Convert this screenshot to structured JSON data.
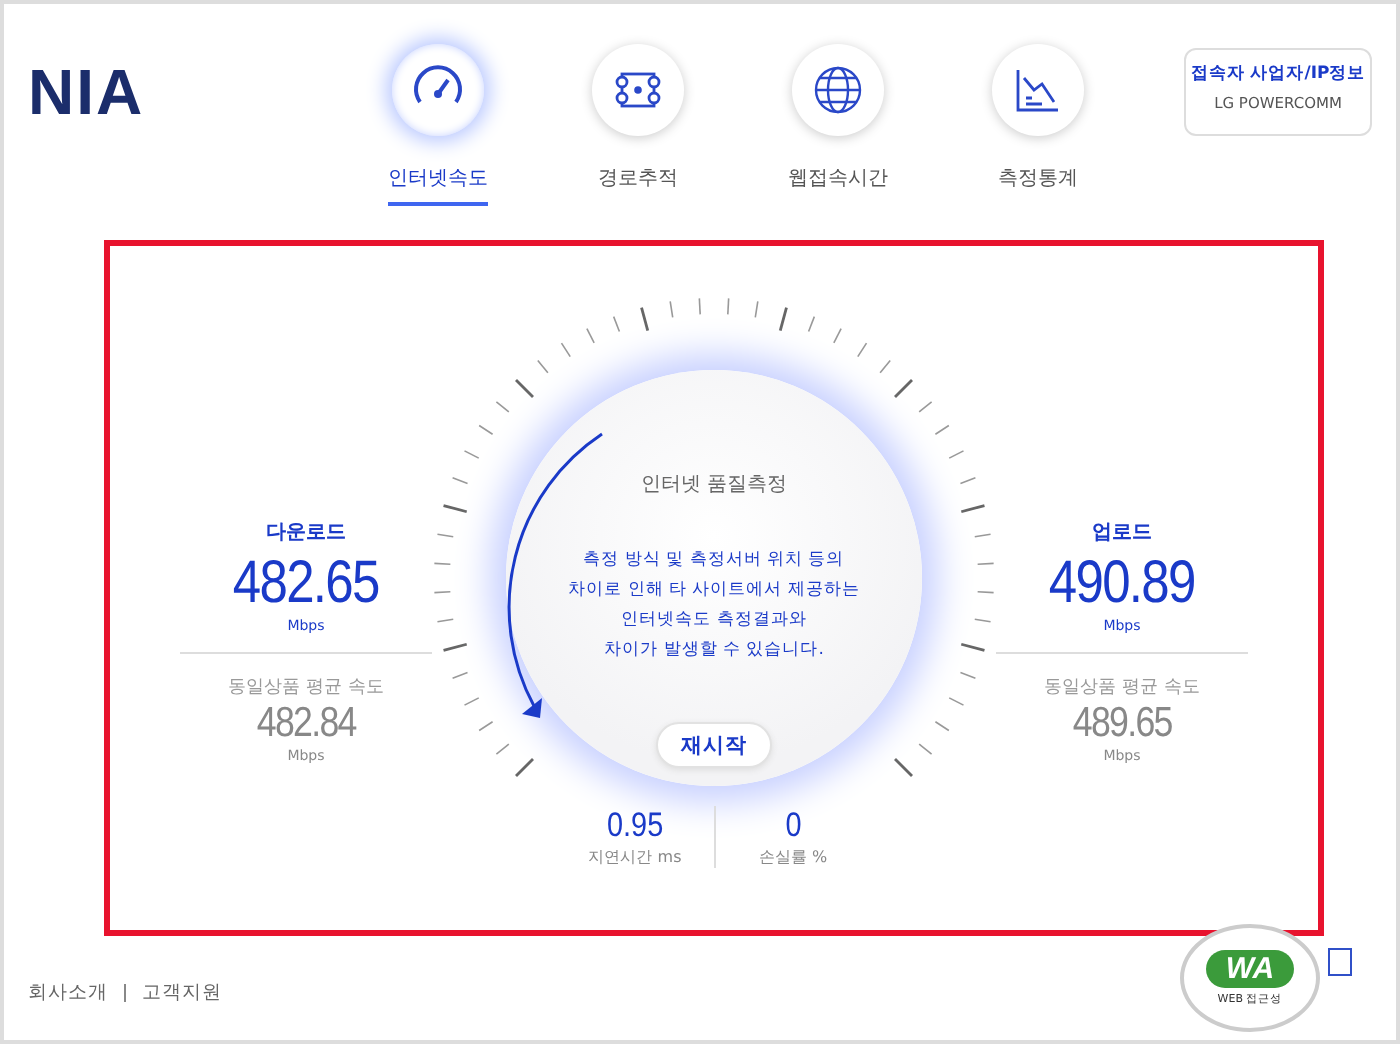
{
  "logo": "NIA",
  "nav": [
    {
      "label": "인터넷속도",
      "kind": "speed",
      "selected": true
    },
    {
      "label": "경로추적",
      "kind": "route",
      "selected": false
    },
    {
      "label": "웹접속시간",
      "kind": "web",
      "selected": false
    },
    {
      "label": "측정통계",
      "kind": "stats",
      "selected": false
    }
  ],
  "provider": {
    "title": "접속자 사업자/IP정보",
    "name": "LG POWERCOMM"
  },
  "download": {
    "label": "다운로드",
    "value": "482.65",
    "unit": "Mbps",
    "avg_label": "동일상품 평균 속도",
    "avg_value": "482.84",
    "avg_unit": "Mbps"
  },
  "upload": {
    "label": "업로드",
    "value": "490.89",
    "unit": "Mbps",
    "avg_label": "동일상품 평균 속도",
    "avg_value": "489.65",
    "avg_unit": "Mbps"
  },
  "gauge": {
    "title": "인터넷 품질측정",
    "notice": [
      "측정 방식 및 측정서버 위치 등의",
      "차이로 인해 타 사이트에서 제공하는",
      "인터넷속도 측정결과와",
      "차이가 발생할 수 있습니다."
    ],
    "button": "재시작"
  },
  "latency": {
    "value": "0.95",
    "label": "지연시간",
    "unit": "ms"
  },
  "loss": {
    "value": "0",
    "label": "손실률",
    "unit": "%"
  },
  "footer": {
    "links": [
      "회사소개",
      "고객지원"
    ]
  },
  "badge": {
    "mark": "WA",
    "caption": "WEB 접근성"
  }
}
